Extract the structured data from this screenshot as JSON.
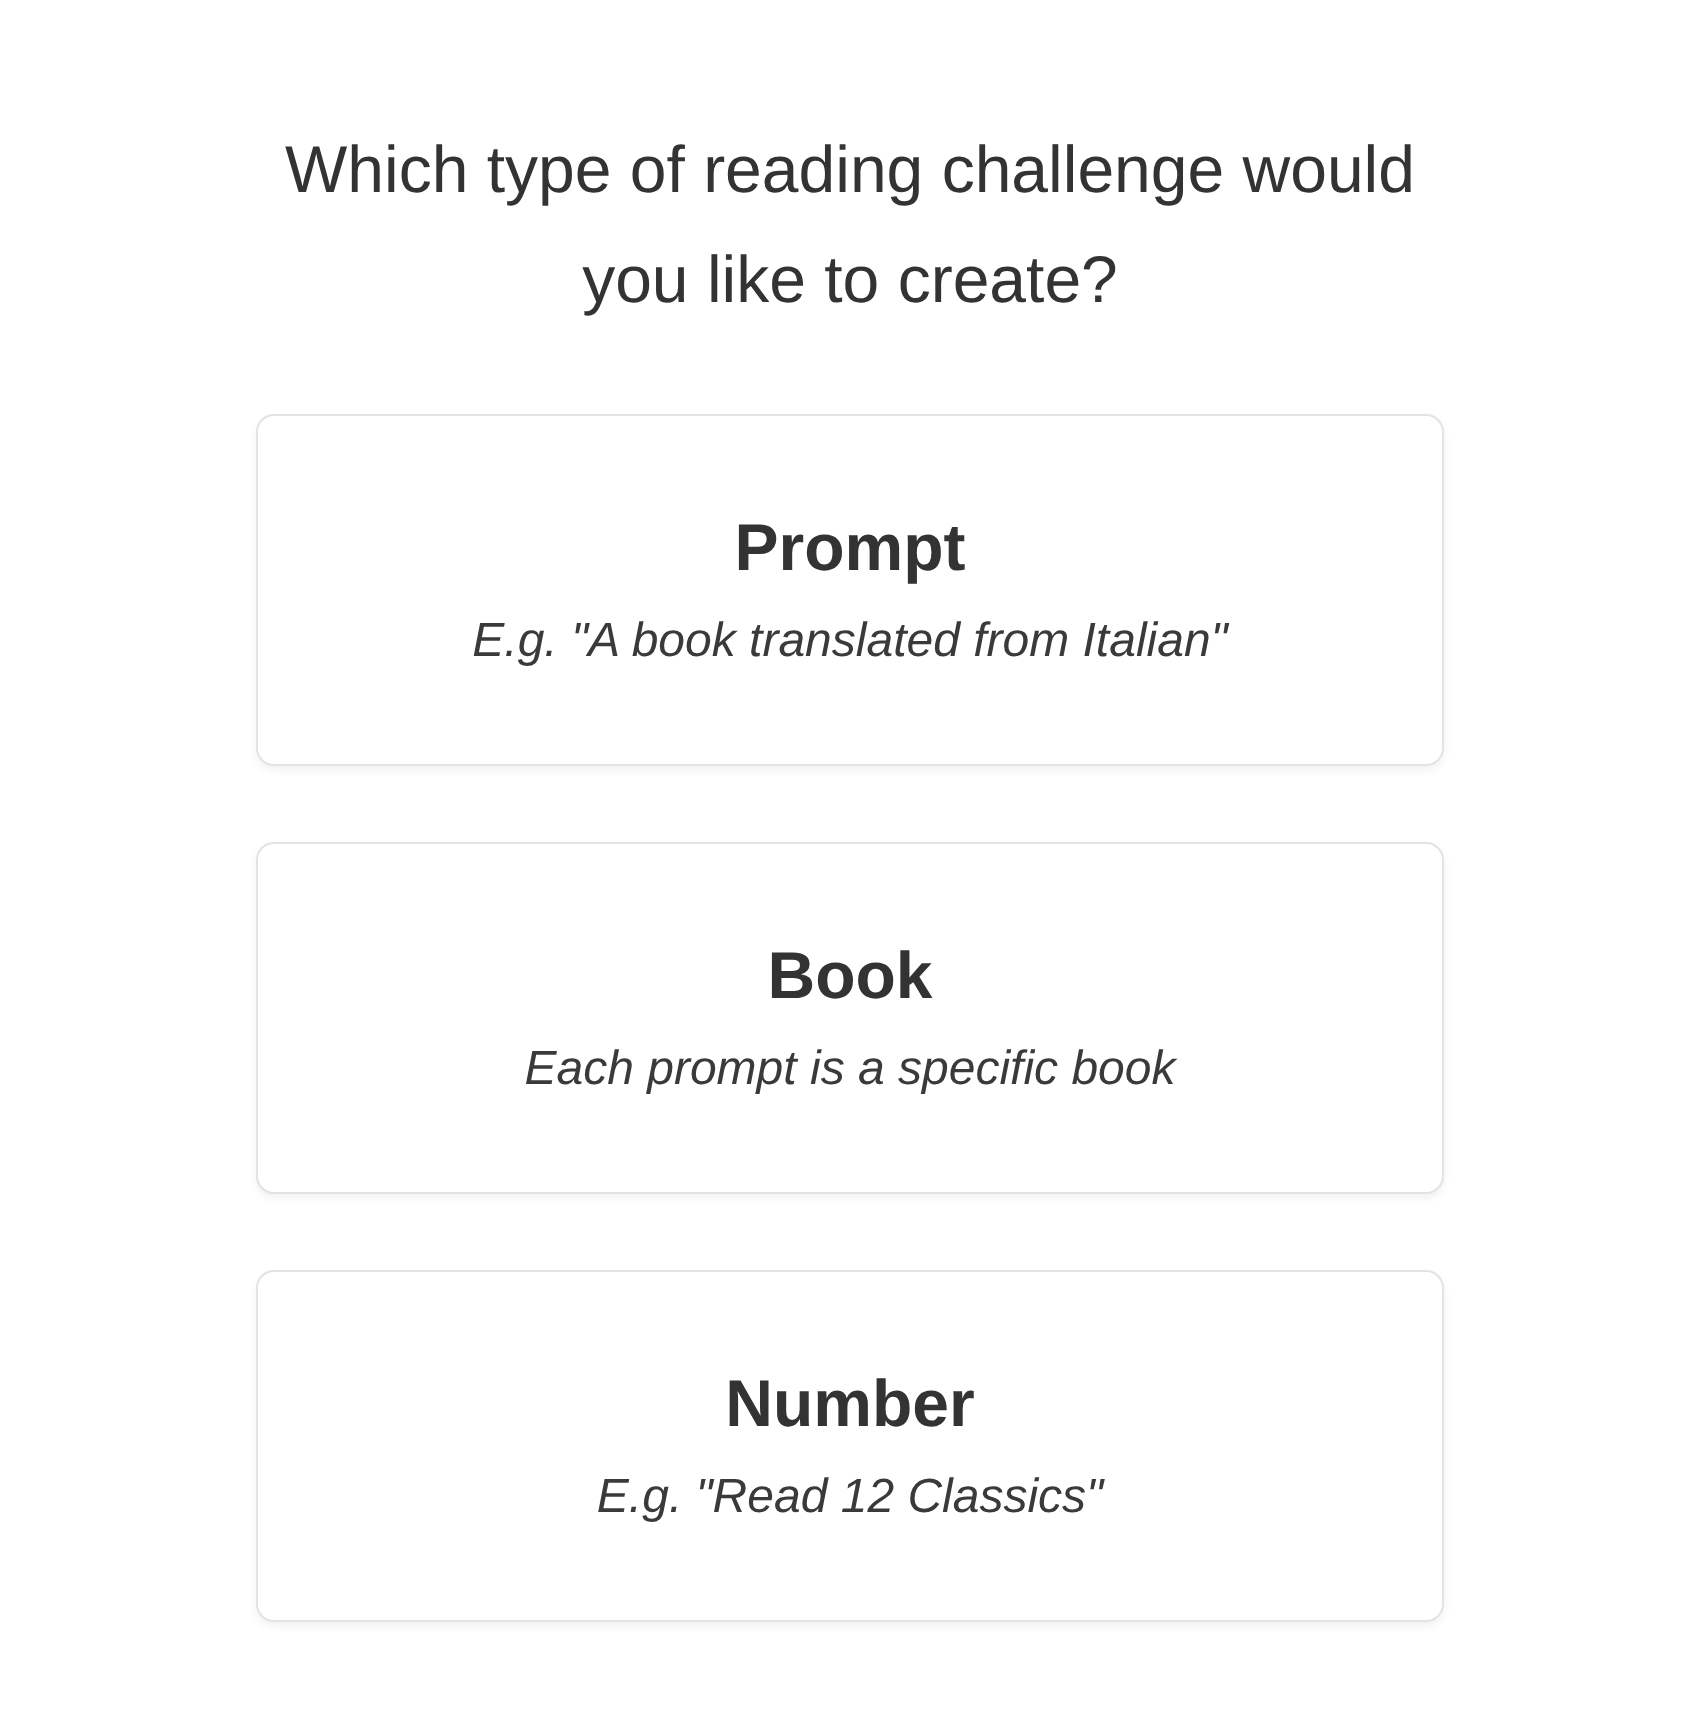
{
  "heading": "Which type of reading challenge would you like to create?",
  "options": [
    {
      "title": "Prompt",
      "description": "E.g. \"A book translated from Italian\""
    },
    {
      "title": "Book",
      "description": "Each prompt is a specific book"
    },
    {
      "title": "Number",
      "description": "E.g. \"Read 12 Classics\""
    }
  ]
}
